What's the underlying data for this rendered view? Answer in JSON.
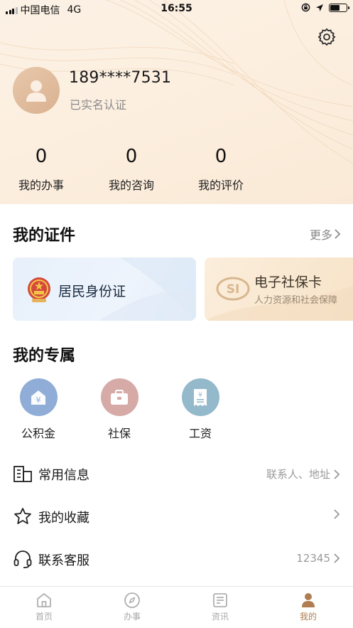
{
  "status_bar": {
    "carrier": "中国电信",
    "network": "4G",
    "time": "16:55",
    "battery_level": 0.6
  },
  "profile": {
    "phone": "189****7531",
    "verification_status": "已实名认证"
  },
  "stats": [
    {
      "value": "0",
      "label": "我的办事"
    },
    {
      "value": "0",
      "label": "我的咨询"
    },
    {
      "value": "0",
      "label": "我的评价"
    }
  ],
  "certificates": {
    "title": "我的证件",
    "more_label": "更多",
    "cards": [
      {
        "title": "居民身份证"
      },
      {
        "title": "电子社保卡",
        "subtitle": "人力资源和社会保障"
      }
    ]
  },
  "exclusive": {
    "title": "我的专属",
    "items": [
      {
        "label": "公积金",
        "icon": "housing-fund-icon",
        "glyph": "¥",
        "color": "#8aa8d2"
      },
      {
        "label": "社保",
        "icon": "social-security-icon",
        "color": "#d2a7a3"
      },
      {
        "label": "工资",
        "icon": "salary-icon",
        "glyph": "¥",
        "color": "#8fb6c8"
      }
    ]
  },
  "menu": [
    {
      "label": "常用信息",
      "hint": "联系人、地址",
      "icon": "building-icon"
    },
    {
      "label": "我的收藏",
      "hint": "",
      "icon": "star-icon"
    },
    {
      "label": "联系客服",
      "hint": "12345",
      "icon": "headset-icon"
    }
  ],
  "tabs": [
    {
      "label": "首页",
      "icon": "home-icon"
    },
    {
      "label": "办事",
      "icon": "compass-icon"
    },
    {
      "label": "资讯",
      "icon": "news-icon"
    },
    {
      "label": "我的",
      "icon": "profile-icon",
      "active": true
    }
  ],
  "colors": {
    "accent": "#b07d52",
    "hero_bg": "#fbf1e4"
  }
}
